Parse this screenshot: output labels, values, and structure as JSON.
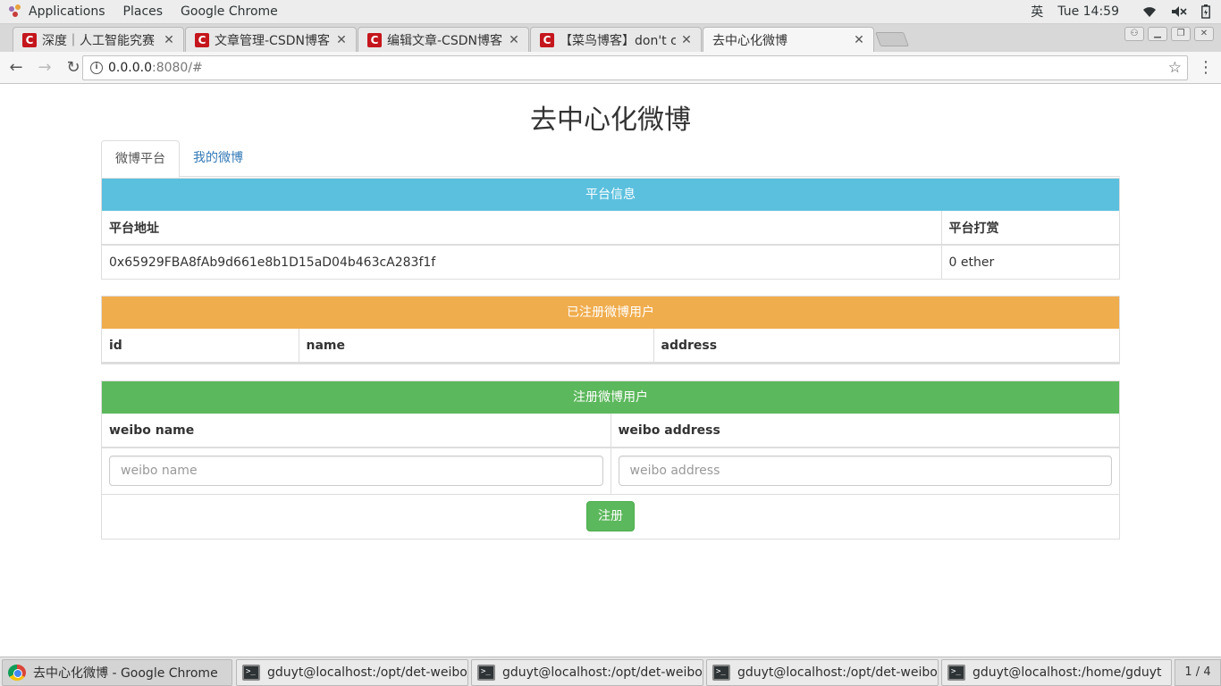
{
  "topbar": {
    "applications": "Applications",
    "places": "Places",
    "app_name": "Google Chrome",
    "input_method": "英",
    "clock": "Tue 14:59"
  },
  "tabs": [
    {
      "title": "深度｜人工智能究赛",
      "icon": "csdn-c-icon"
    },
    {
      "title": "文章管理-CSDN博客",
      "icon": "csdn-c-icon"
    },
    {
      "title": "编辑文章-CSDN博客",
      "icon": "csdn-c-icon"
    },
    {
      "title": "【菜鸟博客】don't c",
      "icon": "csdn-c-icon"
    },
    {
      "title": "去中心化微博",
      "icon": "page-icon",
      "active": true
    }
  ],
  "address": {
    "host": "0.0.0.0",
    "rest": ":8080/#"
  },
  "page": {
    "title": "去中心化微博",
    "nav_tabs": [
      {
        "label": "微博平台",
        "active": true
      },
      {
        "label": "我的微博",
        "active": false
      }
    ],
    "platform": {
      "heading": "平台信息",
      "color": "#5bc0de",
      "columns": [
        "平台地址",
        "平台打赏"
      ],
      "row": [
        "0x65929FBA8fAb9d661e8b1D15aD04b463cA283f1f",
        "0 ether"
      ]
    },
    "registered": {
      "heading": "已注册微博用户",
      "color": "#f0ad4e",
      "columns": [
        "id",
        "name",
        "address"
      ]
    },
    "register": {
      "heading": "注册微博用户",
      "color": "#5cb85c",
      "columns": [
        "weibo name",
        "weibo address"
      ],
      "name_placeholder": "weibo name",
      "address_placeholder": "weibo address",
      "submit_label": "注册"
    }
  },
  "taskbar": {
    "items": [
      {
        "label": "去中心化微博 - Google Chrome",
        "icon": "chrome-icon",
        "active": true
      },
      {
        "label": "gduyt@localhost:/opt/det-weibo/app",
        "icon": "terminal-icon"
      },
      {
        "label": "gduyt@localhost:/opt/det-weibo/app",
        "icon": "terminal-icon"
      },
      {
        "label": "gduyt@localhost:/opt/det-weibo/app",
        "icon": "terminal-icon"
      },
      {
        "label": "gduyt@localhost:/home/gduyt",
        "icon": "terminal-icon"
      }
    ],
    "workspace": "1 / 4"
  }
}
